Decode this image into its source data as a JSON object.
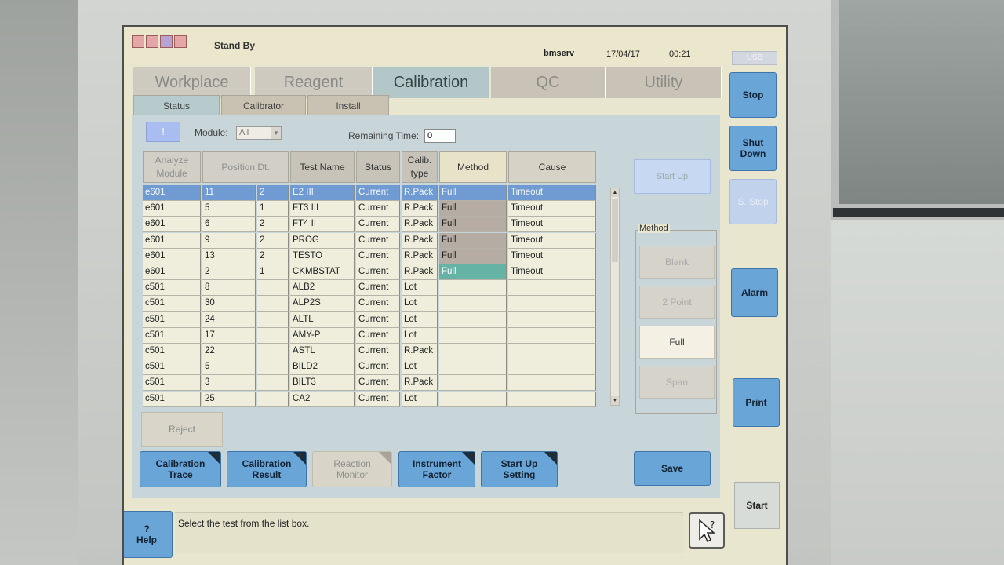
{
  "header": {
    "status": "Stand By",
    "user": "bmserv",
    "date": "17/04/17",
    "time": "00:21",
    "usb": "USB",
    "led_colors": [
      "#e4a6a6",
      "#e4a6a6",
      "#b6a3d4",
      "#e4a6a6"
    ]
  },
  "tabs": [
    "Workplace",
    "Reagent",
    "Calibration",
    "QC",
    "Utility"
  ],
  "active_tab": "Calibration",
  "subtabs": [
    "Status",
    "Calibrator",
    "Install"
  ],
  "active_subtab": "Status",
  "filter": {
    "info_label": "!",
    "module_label": "Module:",
    "module_value": "All",
    "remaining_label": "Remaining Time:",
    "remaining_value": "0"
  },
  "table": {
    "headers": {
      "analyze_module": "Analyze Module",
      "position_dt": "Position Dt.",
      "test_name": "Test Name",
      "status": "Status",
      "calib_type": "Calib. type",
      "method": "Method",
      "cause": "Cause"
    },
    "rows": [
      {
        "module": "e601",
        "pos": "11",
        "dt": "2",
        "test": "E2 III",
        "status": "Current",
        "type": "R.Pack",
        "method": "Full",
        "cause": "Timeout"
      },
      {
        "module": "e601",
        "pos": "5",
        "dt": "1",
        "test": "FT3 III",
        "status": "Current",
        "type": "R.Pack",
        "method": "Full",
        "cause": "Timeout"
      },
      {
        "module": "e601",
        "pos": "6",
        "dt": "2",
        "test": "FT4 II",
        "status": "Current",
        "type": "R.Pack",
        "method": "Full",
        "cause": "Timeout"
      },
      {
        "module": "e601",
        "pos": "9",
        "dt": "2",
        "test": "PROG",
        "status": "Current",
        "type": "R.Pack",
        "method": "Full",
        "cause": "Timeout"
      },
      {
        "module": "e601",
        "pos": "13",
        "dt": "2",
        "test": "TESTO",
        "status": "Current",
        "type": "R.Pack",
        "method": "Full",
        "cause": "Timeout"
      },
      {
        "module": "e601",
        "pos": "2",
        "dt": "1",
        "test": "CKMBSTAT",
        "status": "Current",
        "type": "R.Pack",
        "method": "Full",
        "cause": "Timeout"
      },
      {
        "module": "c501",
        "pos": "8",
        "dt": "",
        "test": "ALB2",
        "status": "Current",
        "type": "Lot",
        "method": "",
        "cause": ""
      },
      {
        "module": "c501",
        "pos": "30",
        "dt": "",
        "test": "ALP2S",
        "status": "Current",
        "type": "Lot",
        "method": "",
        "cause": ""
      },
      {
        "module": "c501",
        "pos": "24",
        "dt": "",
        "test": "ALTL",
        "status": "Current",
        "type": "Lot",
        "method": "",
        "cause": ""
      },
      {
        "module": "c501",
        "pos": "17",
        "dt": "",
        "test": "AMY-P",
        "status": "Current",
        "type": "Lot",
        "method": "",
        "cause": ""
      },
      {
        "module": "c501",
        "pos": "22",
        "dt": "",
        "test": "ASTL",
        "status": "Current",
        "type": "R.Pack",
        "method": "",
        "cause": ""
      },
      {
        "module": "c501",
        "pos": "5",
        "dt": "",
        "test": "BILD2",
        "status": "Current",
        "type": "Lot",
        "method": "",
        "cause": ""
      },
      {
        "module": "c501",
        "pos": "3",
        "dt": "",
        "test": "BILT3",
        "status": "Current",
        "type": "R.Pack",
        "method": "",
        "cause": ""
      },
      {
        "module": "c501",
        "pos": "25",
        "dt": "",
        "test": "CA2",
        "status": "Current",
        "type": "Lot",
        "method": "",
        "cause": ""
      }
    ]
  },
  "buttons": {
    "reject": "Reject",
    "calibration_trace": "Calibration Trace",
    "calibration_result": "Calibration Result",
    "reaction_monitor": "Reaction Monitor",
    "instrument_factor": "Instrument Factor",
    "start_up_setting": "Start Up Setting",
    "save": "Save",
    "start_up": "Start Up"
  },
  "method_panel": {
    "title": "Method",
    "options": [
      "Blank",
      "2 Point",
      "Full",
      "Span"
    ],
    "selected": "Full"
  },
  "side": {
    "stop": "Stop",
    "shut_down": "Shut Down",
    "s_stop": "S. Stop",
    "alarm": "Alarm",
    "print": "Print",
    "start": "Start"
  },
  "message": "Select the test from the list box.",
  "help": {
    "icon": "?",
    "label": "Help"
  }
}
